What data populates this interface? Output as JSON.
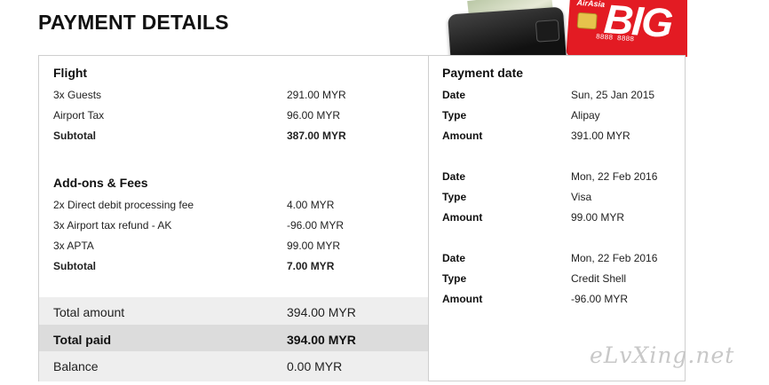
{
  "page": {
    "title": "PAYMENT DETAILS"
  },
  "promo": {
    "card_logo": "AirAsia",
    "card_text": "BIG",
    "card_number": "8888 8888",
    "icons": [
      "wallet-icon",
      "credit-card-icon"
    ]
  },
  "flight": {
    "title": "Flight",
    "items": [
      {
        "label": "3x Guests",
        "value": "291.00 MYR"
      },
      {
        "label": "Airport Tax",
        "value": "96.00 MYR"
      }
    ],
    "subtotal": {
      "label": "Subtotal",
      "value": "387.00 MYR"
    }
  },
  "addons": {
    "title": "Add-ons & Fees",
    "items": [
      {
        "label": "2x Direct debit processing fee",
        "value": "4.00 MYR"
      },
      {
        "label": "3x Airport tax refund - AK",
        "value": "-96.00 MYR"
      },
      {
        "label": "3x APTA",
        "value": "99.00 MYR"
      }
    ],
    "subtotal": {
      "label": "Subtotal",
      "value": "7.00 MYR"
    }
  },
  "summary": {
    "total_amount": {
      "label": "Total amount",
      "value": "394.00 MYR"
    },
    "total_paid": {
      "label": "Total paid",
      "value": "394.00 MYR"
    },
    "balance": {
      "label": "Balance",
      "value": "0.00 MYR"
    }
  },
  "payments": {
    "title": "Payment date",
    "entries": [
      {
        "date_label": "Date",
        "date": "Sun, 25 Jan 2015",
        "type_label": "Type",
        "type": "Alipay",
        "amount_label": "Amount",
        "amount": "391.00 MYR"
      },
      {
        "date_label": "Date",
        "date": "Mon, 22 Feb 2016",
        "type_label": "Type",
        "type": "Visa",
        "amount_label": "Amount",
        "amount": "99.00 MYR"
      },
      {
        "date_label": "Date",
        "date": "Mon, 22 Feb 2016",
        "type_label": "Type",
        "type": "Credit Shell",
        "amount_label": "Amount",
        "amount": "-96.00 MYR"
      }
    ]
  },
  "watermark": "eLvXing.net"
}
